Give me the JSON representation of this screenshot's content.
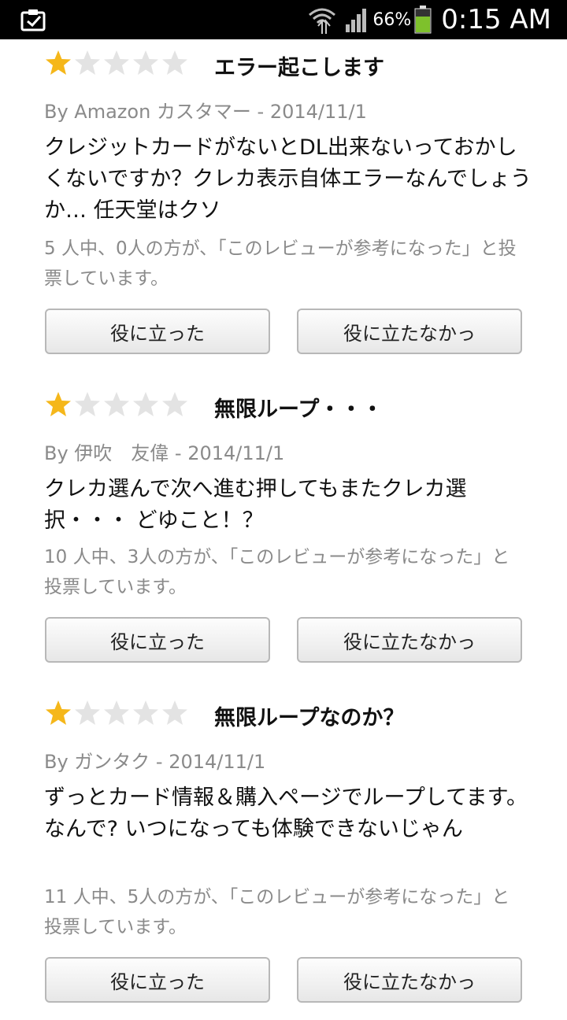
{
  "status_bar": {
    "battery_percent": "66%",
    "time": "0:15 AM",
    "battery_color": "#7ec12c"
  },
  "reviews": [
    {
      "rating": 1,
      "max_rating": 5,
      "title": "エラー起こします",
      "byline": "By Amazon カスタマー - 2014/11/1",
      "body": "クレジットカードがないとDL出来ないっておかしくないですか？クレカ表示自体エラーなんでしょうか… 任天堂はクソ",
      "helpful": "5 人中、0人の方が、「このレビューが参考になった」と投票しています。",
      "yes_label": "役に立った",
      "no_label": "役に立たなかっ"
    },
    {
      "rating": 1,
      "max_rating": 5,
      "title": "無限ループ・・・",
      "byline": "By 伊吹　友偉 - 2014/11/1",
      "body": "クレカ選んで次へ進む押してもまたクレカ選択・・・ どゆこと！？",
      "helpful": "10 人中、3人の方が、「このレビューが参考になった」と投票しています。",
      "yes_label": "役に立った",
      "no_label": "役に立たなかっ"
    },
    {
      "rating": 1,
      "max_rating": 5,
      "title": "無限ループなのか？",
      "byline": "By ガンタク - 2014/11/1",
      "body": "ずっとカード情報＆購入ページでループしてます。 なんで? いつになっても体験できないじゃん",
      "helpful": "11 人中、5人の方が、「このレビューが参考になった」と投票しています。",
      "yes_label": "役に立った",
      "no_label": "役に立たなかっ"
    }
  ],
  "colors": {
    "star_filled": "#f5b71a",
    "star_empty": "#e3e3e3"
  }
}
